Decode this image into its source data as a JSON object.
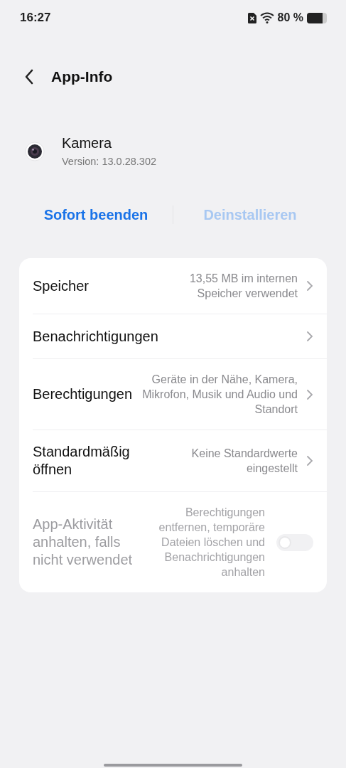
{
  "status_bar": {
    "time": "16:27",
    "battery": "80 %"
  },
  "header": {
    "title": "App-Info"
  },
  "app": {
    "name": "Kamera",
    "version": "Version: 13.0.28.302"
  },
  "actions": [
    {
      "label": "Sofort beenden",
      "disabled": false
    },
    {
      "label": "Deinstallieren",
      "disabled": true
    }
  ],
  "settings": [
    {
      "kind": "link",
      "title": "Speicher",
      "value": "13,55 MB im internen Speicher verwendet",
      "disabled": false
    },
    {
      "kind": "link",
      "title": "Benachrichtigungen",
      "disabled": false
    },
    {
      "kind": "link",
      "title": "Berechtigungen",
      "value": "Geräte in der Nähe, Kamera, Mikrofon, Musik und Audio und Standort",
      "disabled": false
    },
    {
      "kind": "link",
      "title": "Standardmäßig öffnen",
      "value": "Keine Standardwerte eingestellt",
      "disabled": false
    },
    {
      "kind": "toggle",
      "title": "App-Aktivität anhalten, falls nicht verwendet",
      "value": "Berechtigungen entfernen, temporäre Dateien löschen und Benachrichtigungen anhalten",
      "disabled": true,
      "on": false
    }
  ]
}
